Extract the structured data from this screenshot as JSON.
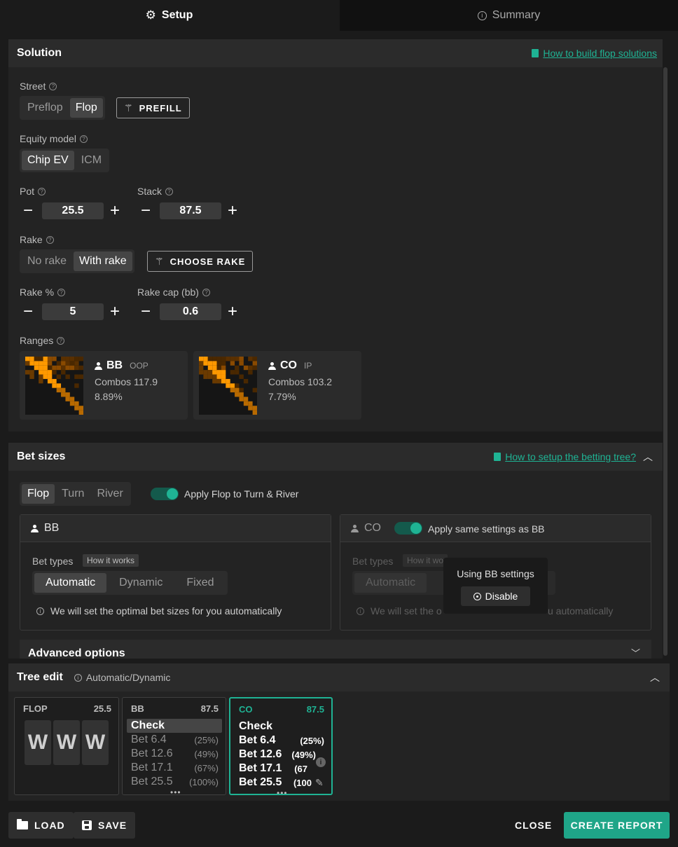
{
  "tabs": {
    "setup": "Setup",
    "summary": "Summary"
  },
  "solution": {
    "title": "Solution",
    "help_link": "How to build flop solutions",
    "street_label": "Street",
    "street_options": [
      "Preflop",
      "Flop"
    ],
    "street_selected": "Flop",
    "prefill": "PREFILL",
    "equity_label": "Equity model",
    "equity_options": [
      "Chip EV",
      "ICM"
    ],
    "equity_selected": "Chip EV",
    "pot_label": "Pot",
    "pot_value": "25.5",
    "stack_label": "Stack",
    "stack_value": "87.5",
    "rake_label": "Rake",
    "rake_options": [
      "No rake",
      "With rake"
    ],
    "rake_selected": "With rake",
    "choose_rake": "CHOOSE RAKE",
    "rake_pct_label": "Rake %",
    "rake_pct_value": "5",
    "rake_cap_label": "Rake cap (bb)",
    "rake_cap_value": "0.6",
    "ranges_label": "Ranges",
    "ranges": [
      {
        "player": "BB",
        "position": "OOP",
        "combos": "Combos 117.9",
        "pct": "8.89%"
      },
      {
        "player": "CO",
        "position": "IP",
        "combos": "Combos 103.2",
        "pct": "7.79%"
      }
    ]
  },
  "bet_sizes": {
    "title": "Bet sizes",
    "help_link": "How to setup the betting tree?",
    "street_tabs": [
      "Flop",
      "Turn",
      "River"
    ],
    "street_selected": "Flop",
    "apply_label": "Apply Flop to Turn & River",
    "bb": {
      "name": "BB",
      "bet_types_label": "Bet types",
      "how_it_works": "How it works",
      "types": [
        "Automatic",
        "Dynamic",
        "Fixed"
      ],
      "selected": "Automatic",
      "note": "We will set the optimal bet sizes for you automatically"
    },
    "co": {
      "name": "CO",
      "same_label": "Apply same settings as BB",
      "bet_types_label": "Bet types",
      "how_it_works": "How it wo",
      "type_automatic": "Automatic",
      "note_left": "We will set the o",
      "note_right": "u automatically",
      "popover_text": "Using BB settings",
      "disable": "Disable"
    },
    "advanced": "Advanced options"
  },
  "tree_edit": {
    "title": "Tree edit",
    "mode": "Automatic/Dynamic",
    "flop": {
      "label": "FLOP",
      "value": "25.5",
      "cards": [
        "W",
        "W",
        "W"
      ]
    },
    "bb": {
      "label": "BB",
      "value": "87.5",
      "actions": [
        {
          "name": "Check",
          "pct": ""
        },
        {
          "name": "Bet 6.4",
          "pct": "(25%)"
        },
        {
          "name": "Bet 12.6",
          "pct": "(49%)"
        },
        {
          "name": "Bet 17.1",
          "pct": "(67%)"
        },
        {
          "name": "Bet 25.5",
          "pct": "(100%)"
        }
      ]
    },
    "co": {
      "label": "CO",
      "value": "87.5",
      "actions": [
        {
          "name": "Check",
          "pct": ""
        },
        {
          "name": "Bet 6.4",
          "pct": "(25%)"
        },
        {
          "name": "Bet 12.6",
          "pct": "(49%)"
        },
        {
          "name": "Bet 17.1",
          "pct": "(67"
        },
        {
          "name": "Bet 25.5",
          "pct": "(100"
        }
      ]
    }
  },
  "footer": {
    "load": "LOAD",
    "save": "SAVE",
    "close": "CLOSE",
    "create_report": "CREATE REPORT"
  },
  "colors": {
    "accent": "#1fb394",
    "range_orange": "#ff9900"
  }
}
